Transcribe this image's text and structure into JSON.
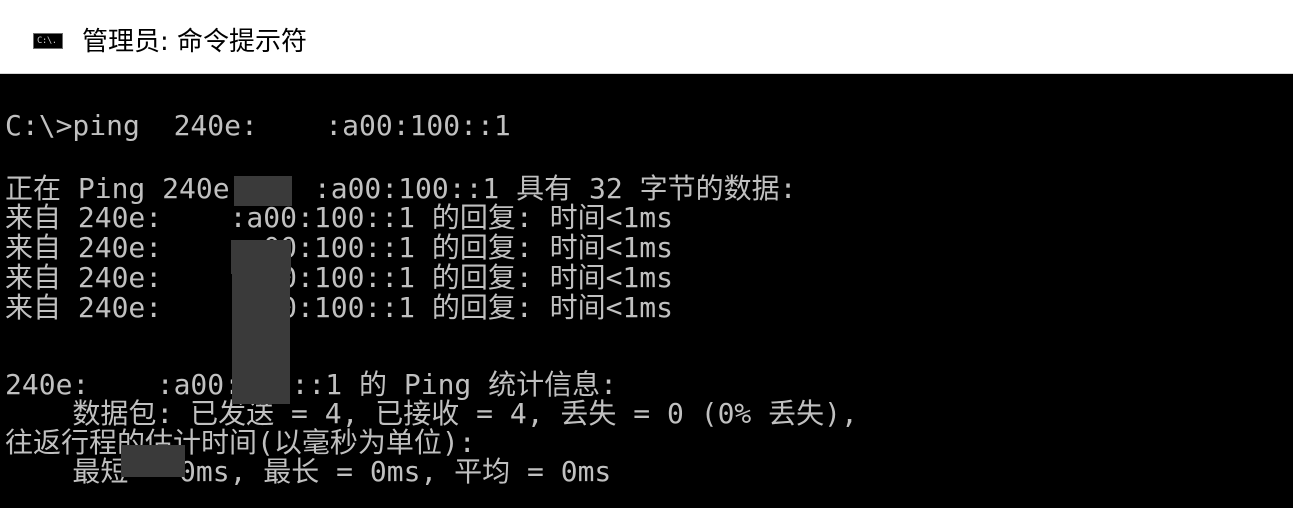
{
  "window": {
    "title": "管理员: 命令提示符",
    "icon_text": "C:\\."
  },
  "console": {
    "lines": [
      "C:\\>ping  240e:    :a00:100::1",
      "正在 Ping 240e:    :a00:100::1 具有 32 字节的数据:",
      "来自 240e:    :a00:100::1 的回复: 时间<1ms",
      "来自 240e:    :a00:100::1 的回复: 时间<1ms",
      "来自 240e:    :a00:100::1 的回复: 时间<1ms",
      "来自 240e:    :a00:100::1 的回复: 时间<1ms",
      "240e:    :a00:100::1 的 Ping 统计信息:",
      "    数据包: 已发送 = 4, 已接收 = 4, 丢失 = 0 (0% 丢失),",
      "往返行程的估计时间(以毫秒为单位):",
      "    最短 = 0ms, 最长 = 0ms, 平均 = 0ms"
    ]
  },
  "colors": {
    "console_background": "#000000",
    "console_text": "#c0c0c0",
    "titlebar_background": "#ffffff",
    "redaction": "#3a3a3a"
  },
  "icons": [
    "cmd-icon"
  ]
}
